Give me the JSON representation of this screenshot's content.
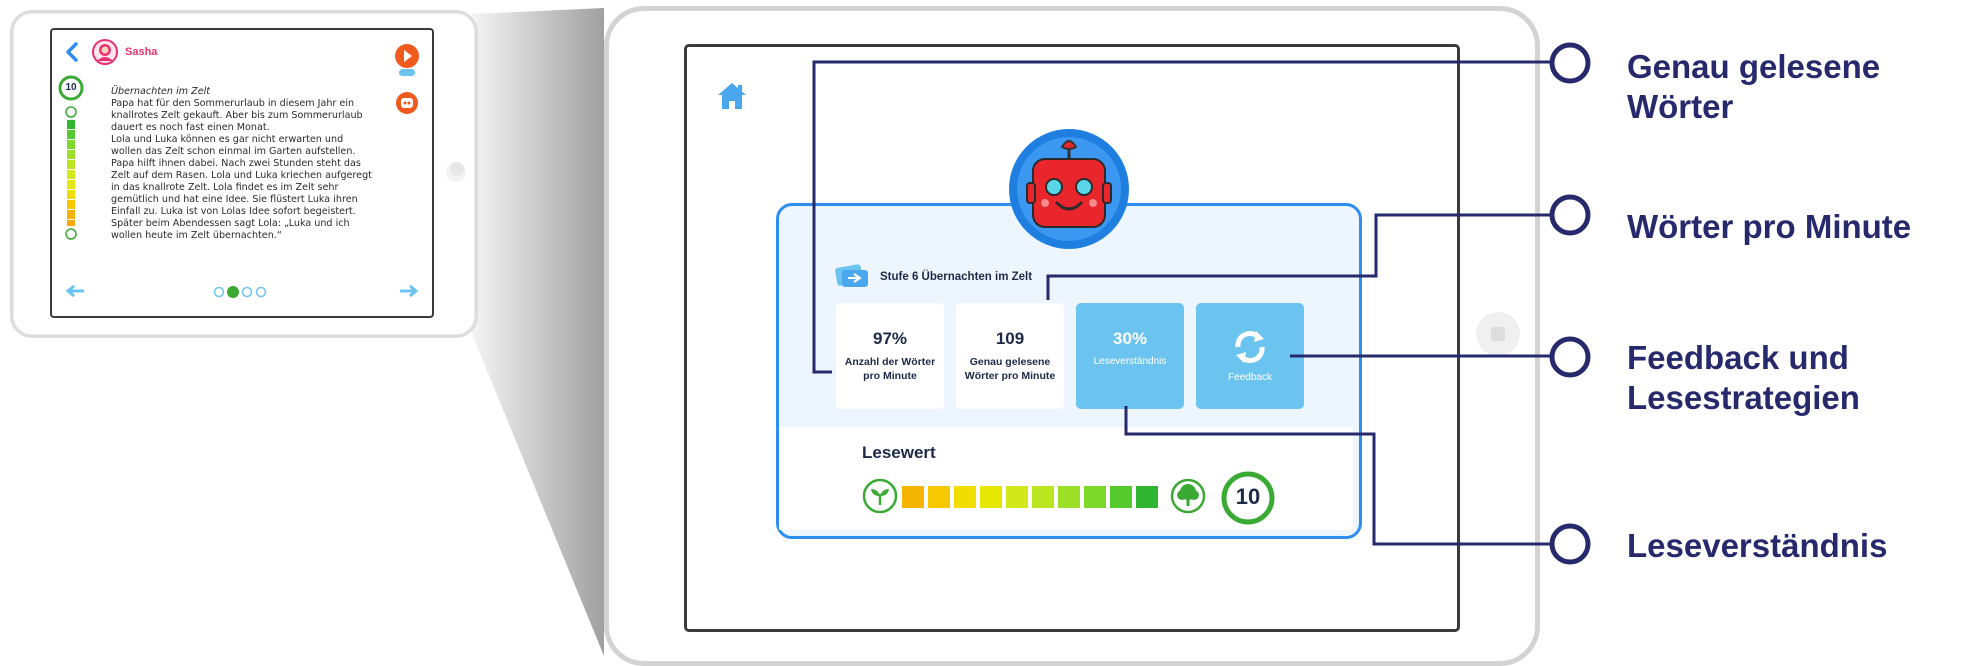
{
  "small_tablet": {
    "user_name": "Sasha",
    "level_badge": "10",
    "story_title": "Übernachten im Zelt",
    "story_lines": [
      "Papa hat für den Sommerurlaub in diesem Jahr ein",
      "knallrotes Zelt gekauft. Aber bis zum Sommerurlaub",
      "dauert es noch fast einen Monat.",
      "Lola und Luka können es gar nicht erwarten und",
      "wollen das Zelt schon einmal im Garten aufstellen.",
      "Papa hilft ihnen dabei. Nach zwei Stunden steht das",
      "Zelt auf dem Rasen. Lola und Luka kriechen aufgeregt",
      "in das knallrote Zelt. Lola findet es im Zelt sehr",
      "gemütlich und hat eine Idee. Sie flüstert Luka ihren",
      "Einfall zu. Luka ist von Lolas Idee sofort begeistert.",
      "Später beim Abendessen sagt Lola: „Luka und ich",
      "wollen heute im Zelt übernachten.“"
    ],
    "meter_levels": 12,
    "page_dots": 4,
    "active_dot": 2
  },
  "big_tablet": {
    "stage_title": "Stufe 6 Übernachten im Zelt",
    "cards": [
      {
        "value": "97%",
        "label_1": "Anzahl der Wörter",
        "label_2": "pro Minute"
      },
      {
        "value": "109",
        "label_1": "Genau gelesene",
        "label_2": "Wörter pro Minute"
      },
      {
        "value": "30%",
        "label_1": "Leseverständnis",
        "label_2": ""
      },
      {
        "value": "",
        "label_1": "Feedback",
        "label_2": ""
      }
    ],
    "reading_value_label": "Lesewert",
    "reading_value": "10",
    "scale_colors": [
      "#f5b400",
      "#f7c800",
      "#f2dd00",
      "#e6e600",
      "#d2e81a",
      "#b9e620",
      "#9be026",
      "#7dd82a",
      "#55c92d",
      "#2fb52f"
    ]
  },
  "callouts": [
    {
      "line1": "Genau gelesene",
      "line2": "Wörter"
    },
    {
      "line1": "Wörter pro Minute",
      "line2": ""
    },
    {
      "line1": "Feedback und",
      "line2": "Lesestrategien"
    },
    {
      "line1": "Leseverständnis",
      "line2": ""
    }
  ],
  "colors": {
    "accent_blue": "#2e8ef0",
    "navy": "#262a6c",
    "light_blue": "#6bc4ef",
    "robot_red": "#e8262c",
    "green": "#3aaa35"
  }
}
